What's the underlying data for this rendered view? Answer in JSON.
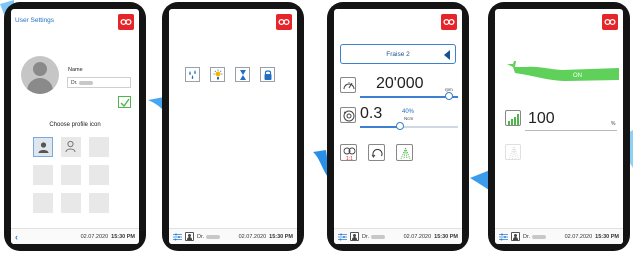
{
  "screens": {
    "user_settings": {
      "title": "User Settings",
      "name_label": "Name",
      "name_value": "Dr.",
      "choose_icon_label": "Choose profile icon",
      "date": "02.07.2020",
      "time": "15:30 PM"
    },
    "quick_settings": {
      "buttons": [
        "water-drops-icon",
        "light-icon",
        "hourglass-icon",
        "lock-icon"
      ],
      "user": "Dr.",
      "date": "02.07.2020",
      "time": "15:30 PM"
    },
    "instrument": {
      "tool_name": "Fraise 2",
      "speed_value": "20'000",
      "speed_unit": "rpm",
      "speed_level": 0.86,
      "torque_value": "0.3",
      "torque_percent": "40%",
      "torque_unit": "Ncm",
      "torque_level": 0.4,
      "user": "Dr.",
      "date": "02.07.2020",
      "time": "15:30 PM"
    },
    "handpiece": {
      "state_label": "ON",
      "level_value": "100",
      "level_unit": "%",
      "user": "Dr.",
      "date": "02.07.2020",
      "time": "15:30 PM"
    }
  },
  "colors": {
    "brand": "#e5252a",
    "accent_blue": "#2d7cd6",
    "confirm_green": "#4fb64a",
    "handpiece_green": "#5fd15a"
  }
}
